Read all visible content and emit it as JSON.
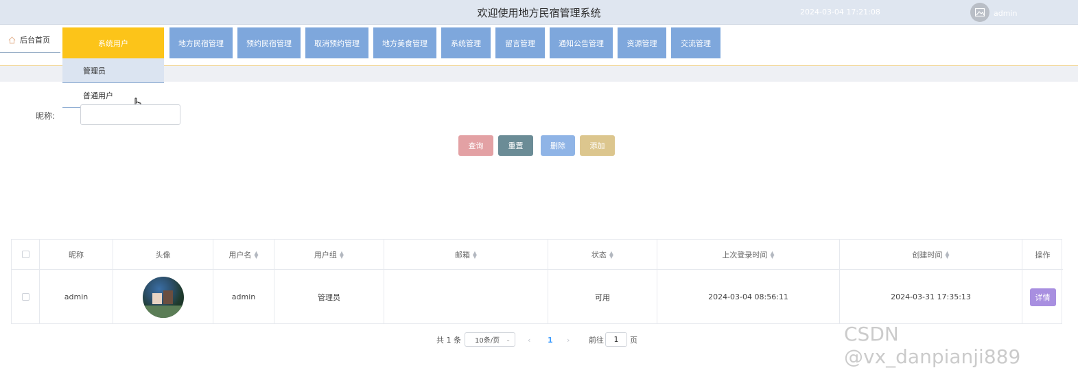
{
  "header": {
    "title": "欢迎使用地方民宿管理系统",
    "datetime": "2024-03-04 17:21:08",
    "username": "admin"
  },
  "nav": {
    "home": "后台首页",
    "items": [
      "系统用户",
      "地方民宿管理",
      "预约民宿管理",
      "取消预约管理",
      "地方美食管理",
      "系统管理",
      "留言管理",
      "通知公告管理",
      "资源管理",
      "交流管理"
    ],
    "dropdown": [
      "管理员",
      "普通用户"
    ]
  },
  "search": {
    "label": "昵称:",
    "value": ""
  },
  "buttons": {
    "query": "查询",
    "reset": "重置",
    "delete": "删除",
    "add": "添加"
  },
  "colors": {
    "nav": "#7ea7dc",
    "nav_active": "#fcc419",
    "query": "#e3a1a4",
    "reset": "#6b8c96",
    "delete": "#8fb4e6",
    "add": "#dcc68e",
    "detail": "#a88fe0"
  },
  "table": {
    "headers": [
      "昵称",
      "头像",
      "用户名",
      "用户组",
      "邮箱",
      "状态",
      "上次登录时间",
      "创建时间",
      "操作"
    ],
    "rows": [
      {
        "nickname": "admin",
        "username": "admin",
        "group": "管理员",
        "email": "",
        "status": "可用",
        "last_login": "2024-03-04 08:56:11",
        "created": "2024-03-31 17:35:13",
        "action": "详情"
      }
    ]
  },
  "pagination": {
    "total": "共 1 条",
    "page_size": "10条/页",
    "current": "1",
    "goto_label": "前往",
    "goto_value": "1",
    "page_suffix": "页"
  },
  "watermark": "CSDN @vx_danpianji889"
}
